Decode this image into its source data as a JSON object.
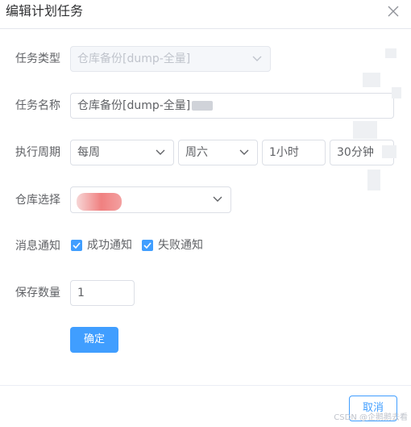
{
  "dialog": {
    "title": "编辑计划任务",
    "close_icon": "close-icon"
  },
  "form": {
    "task_type": {
      "label": "任务类型",
      "value": "仓库备份[dump-全量]",
      "disabled": true
    },
    "task_name": {
      "label": "任务名称",
      "value": "仓库备份[dump-全量]"
    },
    "schedule": {
      "label": "执行周期",
      "frequency": "每周",
      "weekday": "周六",
      "hour": "1小时",
      "minute": "30分钟"
    },
    "repository": {
      "label": "仓库选择"
    },
    "notification": {
      "label": "消息通知",
      "success": {
        "label": "成功通知",
        "checked": true
      },
      "failure": {
        "label": "失败通知",
        "checked": true
      }
    },
    "retention": {
      "label": "保存数量",
      "value": "1"
    }
  },
  "buttons": {
    "confirm": "确定",
    "cancel": "取消"
  },
  "watermark": "CSDN @企鹅鹅去看",
  "colors": {
    "primary": "#409eff",
    "disabled_bg": "#f5f7fa",
    "border": "#dcdfe6"
  }
}
